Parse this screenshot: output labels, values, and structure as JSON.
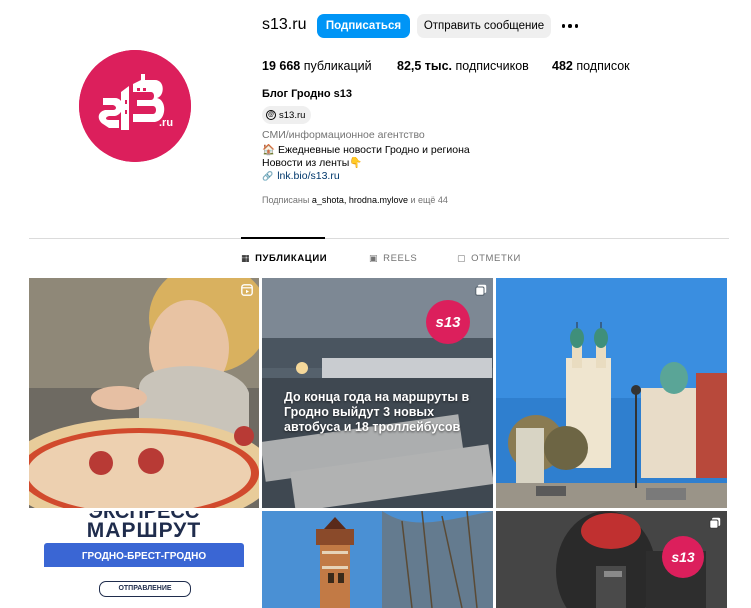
{
  "profile": {
    "username": "s13.ru",
    "follow_label": "Подписаться",
    "message_label": "Отправить сообщение",
    "stats": {
      "posts_value": "19 668",
      "posts_label": "публикаций",
      "followers_value": "82,5 тыс.",
      "followers_label": "подписчиков",
      "following_value": "482",
      "following_label": "подписок"
    },
    "full_name": "Блог Гродно s13",
    "threads_handle": "s13.ru",
    "category": "СМИ/информационное агентство",
    "bio_line1": "🏠 Ежедневные новости Гродно и региона",
    "bio_line2": "Новости из ленты👇",
    "link": "lnk.bio/s13.ru",
    "followed_by_prefix": "Подписаны",
    "followed_by_accounts": "a_shota, hrodna.mylove",
    "followed_by_suffix": "и ещё 44"
  },
  "tabs": [
    {
      "label": "ПУБЛИКАЦИИ",
      "icon": "grid-icon",
      "active": true
    },
    {
      "label": "REELS",
      "icon": "reels-icon",
      "active": false
    },
    {
      "label": "ОТМЕТКИ",
      "icon": "tagged-icon",
      "active": false
    }
  ],
  "posts": [
    {
      "kind": "reel",
      "overlay": ""
    },
    {
      "kind": "carousel",
      "overlay": "До конца года на маршруты в Гродно выйдут 3 новых автобуса и 18 троллейбусов",
      "logo_text": "s13"
    },
    {
      "kind": "photo",
      "overlay": ""
    },
    {
      "kind": "photo",
      "line1": "ЭКСПРЕСС",
      "line2": "МАРШРУТ",
      "line3": "ГРОДНО-БРЕСТ-ГРОДНО",
      "line4": "ОТПРАВЛЕНИЕ"
    },
    {
      "kind": "photo",
      "overlay": ""
    },
    {
      "kind": "carousel",
      "overlay": "",
      "logo_text": "s13"
    }
  ],
  "brand_color": "#dc1f5c",
  "accent_color": "#0095f6"
}
